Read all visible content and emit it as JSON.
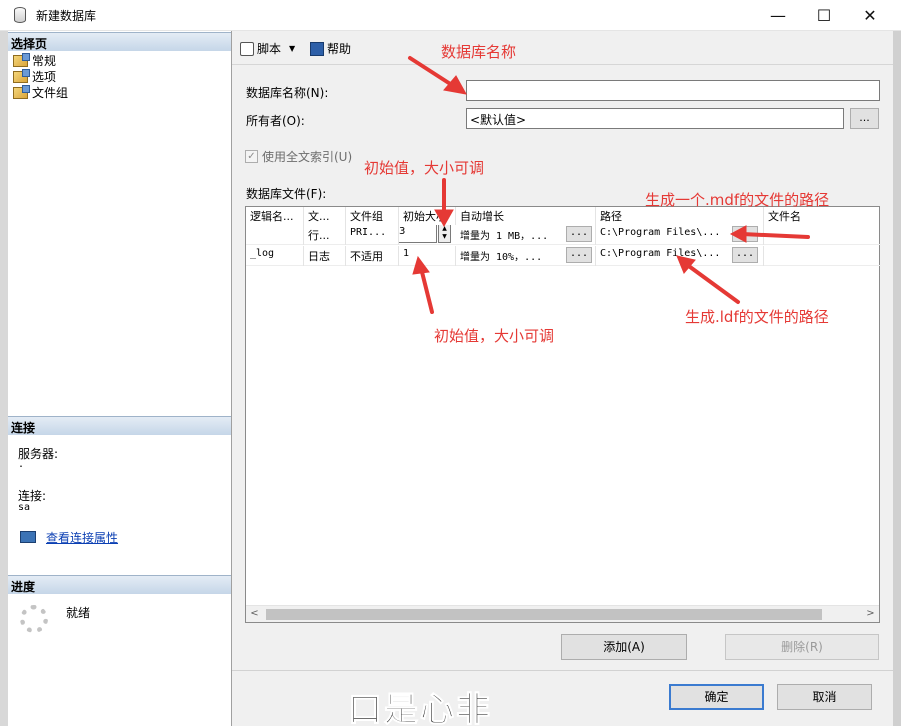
{
  "window": {
    "title": "新建数据库",
    "minimize": "—",
    "maximize": "☐",
    "close": "✕"
  },
  "sidebar": {
    "select_page_header": "选择页",
    "pages": [
      {
        "label": "常规",
        "icon": "page-settings-icon"
      },
      {
        "label": "选项",
        "icon": "page-settings-icon"
      },
      {
        "label": "文件组",
        "icon": "page-settings-icon"
      }
    ],
    "connection_header": "连接",
    "server_label": "服务器:",
    "server_value": ".",
    "connection_label": "连接:",
    "connection_value": "sa",
    "view_connection_link": "查看连接属性",
    "progress_header": "进度",
    "progress_status": "就绪"
  },
  "toolbar": {
    "script_label": "脚本",
    "help_label": "帮助"
  },
  "form": {
    "db_name_label": "数据库名称(N):",
    "db_name_value": "",
    "owner_label": "所有者(O):",
    "owner_value": "<默认值>",
    "owner_browse": "...",
    "fulltext_label": "使用全文索引(U)",
    "fulltext_checked": true,
    "db_files_label": "数据库文件(F):"
  },
  "grid": {
    "columns": [
      "逻辑名...",
      "文...",
      "文件组",
      "初始大小",
      "自动增长",
      "路径",
      "文件名"
    ],
    "rows": [
      {
        "logical": "",
        "type": "行...",
        "filegroup": "PRI...",
        "size": "3",
        "growth": "增量为 1 MB，...",
        "path": "C:\\Program Files\\...",
        "filename": ""
      },
      {
        "logical": "_log",
        "type": "日志",
        "filegroup": "不适用",
        "size": "1",
        "growth": "增量为 10%，...",
        "path": "C:\\Program Files\\...",
        "filename": ""
      }
    ],
    "button_label": "..."
  },
  "buttons": {
    "add": "添加(A)",
    "remove": "删除(R)",
    "ok": "确定",
    "cancel": "取消"
  },
  "annotations": {
    "db_name": "数据库名称",
    "init_size_top": "初始值，大小可调",
    "mdf_path": "生成一个.mdf的文件的路径",
    "init_size_bottom": "初始值，大小可调",
    "ldf_path": "生成.ldf的文件的路径",
    "color": "#e53935"
  },
  "watermark": "口是心非"
}
